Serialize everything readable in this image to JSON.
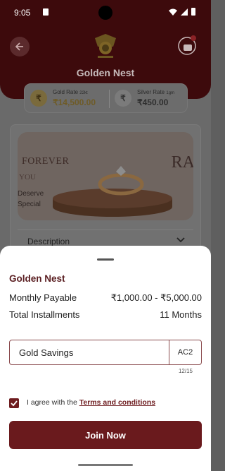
{
  "status_bar": {
    "time": "9:05"
  },
  "page": {
    "title": "Golden Nest",
    "rates": {
      "gold": {
        "label": "Gold Rate",
        "unit": "22kt",
        "value": "₹14,500.00",
        "symbol": "₹"
      },
      "silver": {
        "label": "Silver Rate",
        "unit": "1gm",
        "value": "₹450.00",
        "symbol": "₹"
      }
    },
    "banner": {
      "line1": "FOREVER",
      "line2": "YOU",
      "line3": "Deserve",
      "line4": "Special",
      "right_text": "RA"
    },
    "description_label": "Description"
  },
  "sheet": {
    "title": "Golden Nest",
    "monthly_label": "Monthly Payable",
    "monthly_value": "₹1,000.00 - ₹5,000.00",
    "installments_label": "Total Installments",
    "installments_value": "11 Months",
    "input_value": "Gold Savings",
    "input_suffix": "AC2",
    "char_counter": "12/15",
    "agree_prefix": "I agree with the",
    "terms_link": "Terms and conditions",
    "agree_checked": true,
    "join_label": "Join Now"
  },
  "colors": {
    "brand": "#6a1a1d",
    "header": "#3d0a0c",
    "gold": "#b8962e"
  }
}
